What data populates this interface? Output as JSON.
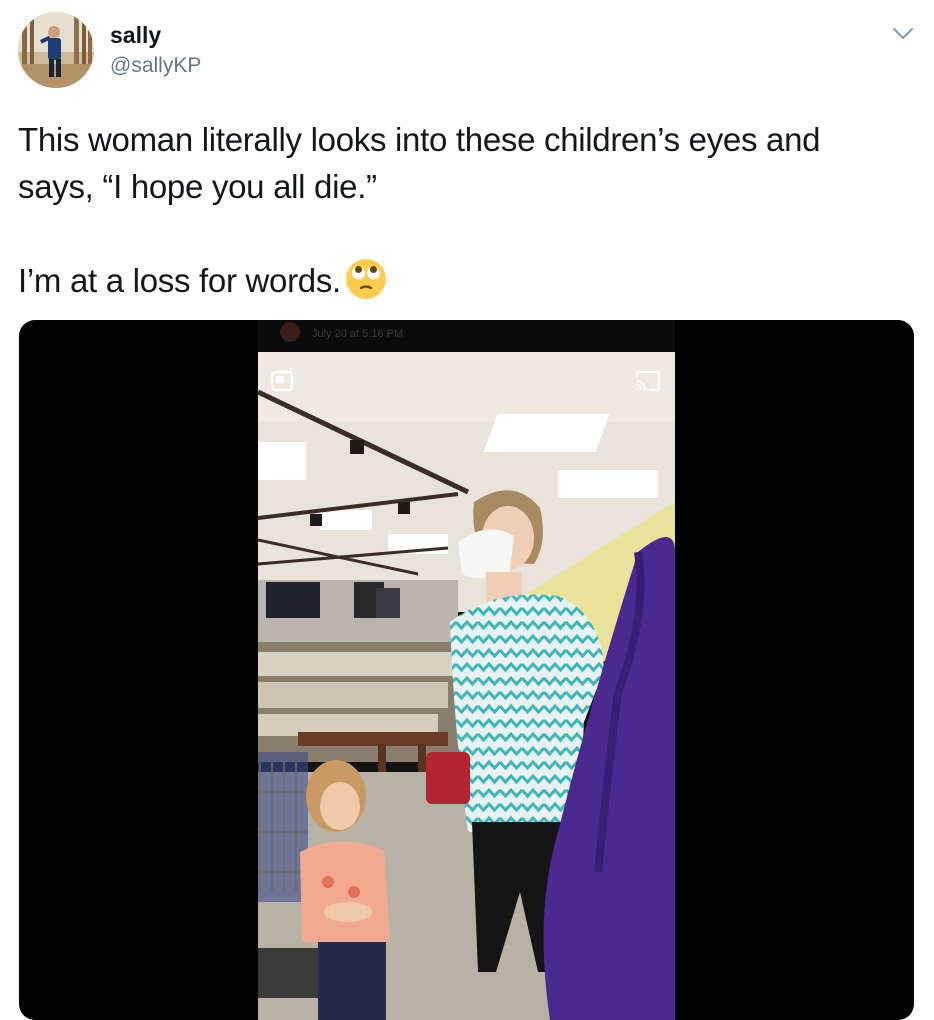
{
  "tweet": {
    "author_name": "sally",
    "author_handle": "@sallyKP",
    "text_line1": "This woman literally looks into these children’s eyes and",
    "text_line2": "says, “I hope you all die.”",
    "text_line3": "I’m at a loss for words.",
    "emoji": "face-with-rolling-eyes-icon"
  },
  "media": {
    "video_timestamp": "July 20 at 5:16 PM",
    "controls": [
      "picture-in-picture-icon",
      "cast-icon"
    ]
  },
  "colors": {
    "text": "#14171a",
    "secondary": "#657786",
    "media_bg": "#000000"
  }
}
